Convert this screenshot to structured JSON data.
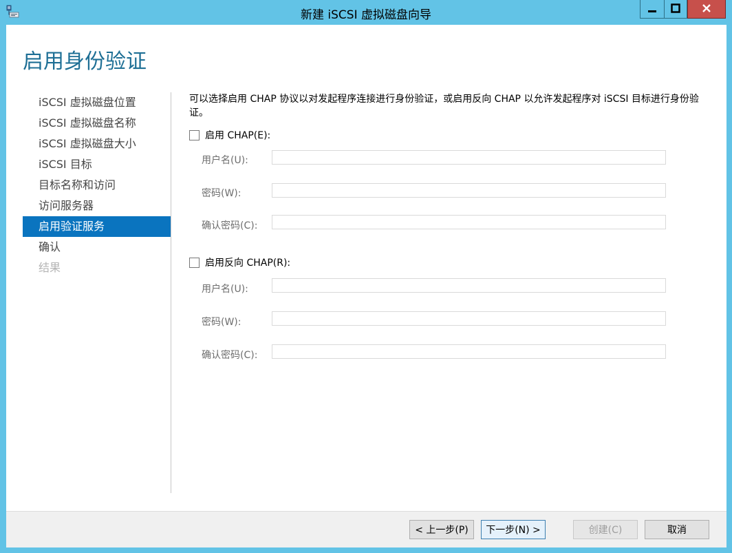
{
  "window": {
    "title": "新建 iSCSI 虚拟磁盘向导",
    "accent": "#62c3e6",
    "close_color": "#c7504b"
  },
  "page": {
    "heading": "启用身份验证",
    "description": "可以选择启用 CHAP 协议以对发起程序连接进行身份验证，或启用反向 CHAP 以允许发起程序对 iSCSI 目标进行身份验证。"
  },
  "steps": [
    {
      "label": "iSCSI 虚拟磁盘位置",
      "state": "normal"
    },
    {
      "label": "iSCSI 虚拟磁盘名称",
      "state": "normal"
    },
    {
      "label": "iSCSI 虚拟磁盘大小",
      "state": "normal"
    },
    {
      "label": "iSCSI 目标",
      "state": "normal"
    },
    {
      "label": "目标名称和访问",
      "state": "normal"
    },
    {
      "label": "访问服务器",
      "state": "normal"
    },
    {
      "label": "启用验证服务",
      "state": "active"
    },
    {
      "label": "确认",
      "state": "normal"
    },
    {
      "label": "结果",
      "state": "disabled"
    }
  ],
  "chap": {
    "checkbox_label": "启用 CHAP(E):",
    "checked": false,
    "username_label": "用户名(U):",
    "username_value": "",
    "password_label": "密码(W):",
    "password_value": "",
    "confirm_label": "确认密码(C):",
    "confirm_value": ""
  },
  "reverse_chap": {
    "checkbox_label": "启用反向 CHAP(R):",
    "checked": false,
    "username_label": "用户名(U):",
    "username_value": "",
    "password_label": "密码(W):",
    "password_value": "",
    "confirm_label": "确认密码(C):",
    "confirm_value": ""
  },
  "footer": {
    "prev_label": "< 上一步(P)",
    "next_label": "下一步(N) >",
    "create_label": "创建(C)",
    "cancel_label": "取消"
  },
  "icons": {
    "app": "server-wizard-icon",
    "minimize": "minimize-icon",
    "maximize": "maximize-icon",
    "close": "close-icon"
  }
}
